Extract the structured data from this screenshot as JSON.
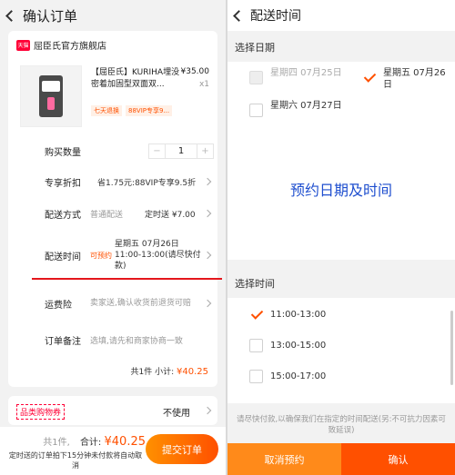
{
  "left": {
    "header_title": "确认订单",
    "store_name": "屈臣氏官方旗舰店",
    "tmall_logo": "天猫",
    "product": {
      "title": "【屈臣氏】KURIHA埋没密着加固型双面双...",
      "price": "¥35.00",
      "qty": "x1",
      "tags": [
        "七天退换",
        "88VIP专享9..."
      ]
    },
    "rows": {
      "quantity_label": "购买数量",
      "quantity_value": "1",
      "minus": "−",
      "plus": "+",
      "discount_label": "专享折扣",
      "discount_text": "省1.75元:88VIP专享9.5折",
      "shipping_label": "配送方式",
      "shipping_text": "普通配送",
      "shipping_price": "定时送 ¥7.00",
      "time_label": "配送时间",
      "preorder_badge": "可预约",
      "time_text": "星期五 07月26日 11:00-13:00(请尽快付款)",
      "insurance_label": "运费险",
      "insurance_text": "卖家送,确认收货前退货可赔",
      "note_label": "订单备注",
      "note_placeholder": "选填,请先和商家协商一致"
    },
    "subtotal": {
      "count": "共1件",
      "label": "小计:",
      "amount": "¥40.25"
    },
    "coupon": {
      "label": "品类购物券",
      "value": "不使用"
    },
    "bottom": {
      "count": "共1件,",
      "total_label": "合计:",
      "total_amount": "¥40.25",
      "notice": "定时送的订单拍下15分钟未付款将自动取消",
      "submit": "提交订单"
    }
  },
  "right": {
    "header_title": "配送时间",
    "date_section_title": "选择日期",
    "dates": [
      {
        "label": "星期四 07月25日",
        "state": "disabled"
      },
      {
        "label": "星期五 07月26日",
        "state": "checked"
      },
      {
        "label": "星期六 07月27日",
        "state": "unchecked"
      }
    ],
    "promo_text": "预约日期及时间",
    "time_section_title": "选择时间",
    "times": [
      {
        "label": "11:00-13:00",
        "state": "checked"
      },
      {
        "label": "13:00-15:00",
        "state": "unchecked"
      },
      {
        "label": "15:00-17:00",
        "state": "unchecked"
      }
    ],
    "hint": "请尽快付款,以确保我们在指定的时间配送(另:不可抗力因素可致延误)",
    "cancel": "取消预约",
    "confirm": "确认"
  },
  "colors": {
    "accent": "#ff5000",
    "cancel_button": "#ff8a1a",
    "promo": "#1f4fcf",
    "underline": "#e4161c"
  }
}
